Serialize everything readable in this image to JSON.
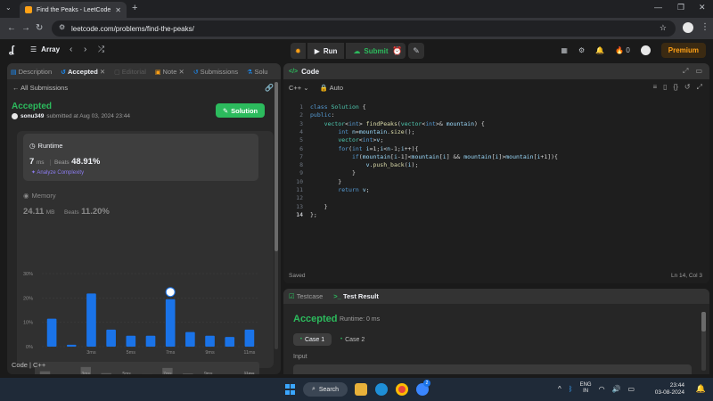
{
  "browser": {
    "tab_title": "Find the Peaks - LeetCode",
    "url": "leetcode.com/problems/find-the-peaks/"
  },
  "nav": {
    "problem_list": "Array",
    "run_label": "Run",
    "submit_label": "Submit",
    "streak_count": "0",
    "premium_label": "Premium"
  },
  "left": {
    "tabs": [
      "Description",
      "Accepted",
      "Editorial",
      "Note",
      "Submissions",
      "Solu"
    ],
    "all_submissions": "All Submissions",
    "status": "Accepted",
    "username": "sonu349",
    "submitted_text": "submitted at Aug 03, 2024 23:44",
    "solution_label": "Solution",
    "runtime_label": "Runtime",
    "runtime_value": "7",
    "runtime_unit": "ms",
    "beats_label": "Beats",
    "runtime_beats": "48.91%",
    "analyze_label": "Analyze Complexity",
    "memory_label": "Memory",
    "memory_value": "24.11",
    "memory_unit": "MB",
    "memory_beats": "11.20%",
    "footer": "Code | C++"
  },
  "chart_data": {
    "type": "bar",
    "y_ticks": [
      "30%",
      "20%",
      "10%",
      "0%"
    ],
    "ylim": [
      0,
      30
    ],
    "x_ticks": [
      "3ms",
      "5ms",
      "7ms",
      "9ms",
      "11ms"
    ],
    "values": [
      11.5,
      0.8,
      21.8,
      7,
      4.5,
      4.5,
      19.5,
      6,
      4.5,
      4,
      7
    ],
    "highlight_index": 6,
    "bar_color": "#1a73e8",
    "mini_x_ticks": [
      "3ms",
      "5ms",
      "7ms",
      "9ms",
      "11ms"
    ]
  },
  "code": {
    "title": "Code",
    "language": "C++",
    "mode": "Auto",
    "lines": [
      "class Solution {",
      "public:",
      "    vector<int> findPeaks(vector<int>& mountain) {",
      "        int n=mountain.size();",
      "        vector<int>v;",
      "        for(int i=1;i<n-1;i++){",
      "            if(mountain[i-1]<mountain[i] && mountain[i]>mountain[i+1]){",
      "                v.push_back(i);",
      "            }",
      "        }",
      "        return v;",
      "",
      "    }",
      "};"
    ],
    "saved": "Saved",
    "cursor": "Ln 14, Col 3"
  },
  "test": {
    "testcase_tab": "Testcase",
    "result_tab": "Test Result",
    "status": "Accepted",
    "runtime": "Runtime: 0 ms",
    "case1": "Case 1",
    "case2": "Case 2",
    "input_label": "Input"
  },
  "taskbar": {
    "search": "Search",
    "lang_top": "ENG",
    "lang_bottom": "IN",
    "time": "23:44",
    "date": "03-08-2024",
    "badge": "2"
  },
  "colors": {
    "accent_green": "#2cbb5d",
    "brand_orange": "#ffa116",
    "chart_blue": "#1a73e8"
  }
}
